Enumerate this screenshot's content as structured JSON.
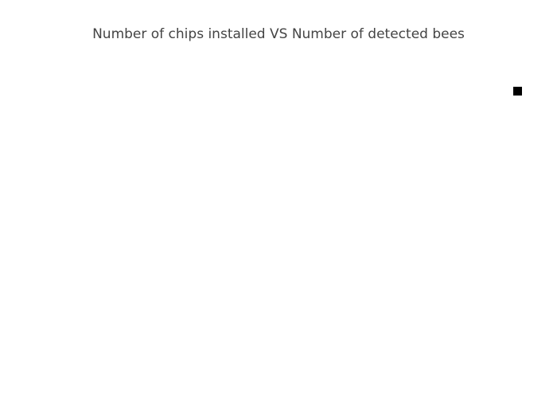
{
  "chart_data": {
    "type": "pie",
    "title": "Number of chips installed VS Number of detected bees",
    "labels": [],
    "values": [],
    "legend": {
      "placement": "top-right",
      "entries": [
        {
          "label": "",
          "color": "#000000"
        }
      ]
    }
  }
}
